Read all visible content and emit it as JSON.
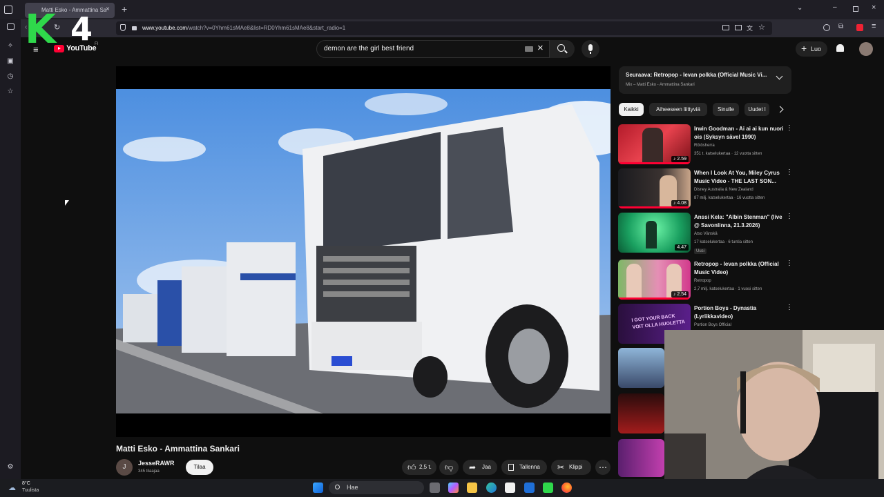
{
  "browser": {
    "tab_title": "Matti Esko - Ammattina Sa",
    "url_prefix": "www.youtube.com",
    "url_rest": "/watch?v=0Yhm61sMAe8&list=RD0Yhm61sMAe8&start_radio=1"
  },
  "overlay_logo": {
    "letter": "K",
    "number": "4"
  },
  "youtube": {
    "logo_text": "YouTube",
    "region": "FI",
    "search_value": "demon are the girl best friend",
    "create_label": "Luo"
  },
  "video": {
    "title": "Matti Esko - Ammattina Sankari",
    "channel_initial": "J",
    "channel_name": "JesseRAWR",
    "subscribers": "345 tilaajaa",
    "subscribe_label": "Tilaa",
    "likes": "2,5 t.",
    "share_label": "Jaa",
    "save_label": "Tallenna",
    "clip_label": "Klippi"
  },
  "up_next": {
    "title": "Seuraava: Retropop - Ievan polkka (Official Music Vi...",
    "subtitle": "Mix – Matti Esko - Ammattina Sankari"
  },
  "chips": [
    "Kaikki",
    "Aiheeseen liittyviä",
    "Sinulle",
    "Uudet l"
  ],
  "related": [
    {
      "title": "Irwin Goodman - Ai ai ai kun nuori ois (Syksyn sävel 1990)",
      "channel": "Rötösherra",
      "meta": "351 t. katselukertaa · 12 vuotta sitten",
      "duration": "2.59",
      "badge": ""
    },
    {
      "title": "When I Look At You, Miley Cyrus Music Video - THE LAST SON...",
      "channel": "Disney Australia & New Zealand",
      "meta": "87 milj. katselukertaa · 16 vuotta sitten",
      "duration": "4.08",
      "badge": ""
    },
    {
      "title": "Anssi Kela: \"Albin Stenman\" (live @ Savonlinna, 21.3.2026)",
      "channel": "Atso Vänskä",
      "meta": "17 katselukertaa · 6 tuntia sitten",
      "duration": "4.47",
      "badge": "Uusi"
    },
    {
      "title": "Retropop - Ievan polkka (Official Music Video)",
      "channel": "Retropop",
      "meta": "2,7 milj. katselukertaa · 1 vuosi sitten",
      "duration": "2.54",
      "badge": ""
    },
    {
      "title": "Portion Boys - Dynastia (Lyriikkavideo)",
      "channel": "Portion Boys Official",
      "meta": "",
      "duration": "",
      "badge": ""
    }
  ],
  "thumb_texts": {
    "portion_boys": "I GOT YOUR BACK VOIT OLLA HUOLETTA"
  },
  "taskbar": {
    "weather_temp": "8°C",
    "weather_desc": "Tuulista",
    "search_label": "Hae"
  },
  "colors": {
    "yt_red": "#ff0033",
    "k4_green": "#2fd84b",
    "page_bg": "#0f0f0f"
  }
}
